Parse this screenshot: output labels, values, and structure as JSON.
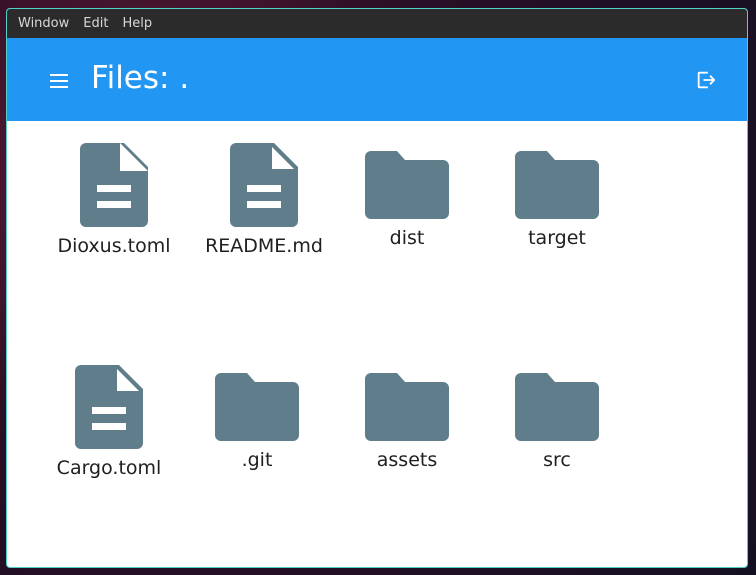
{
  "menubar": {
    "items": [
      "Window",
      "Edit",
      "Help"
    ]
  },
  "header": {
    "title": "Files: .",
    "menu_icon": "hamburger-icon",
    "logout_icon": "logout-icon"
  },
  "colors": {
    "header": "#2196f3",
    "icon": "#607d8b",
    "menubar": "#2b2b2b"
  },
  "files": [
    {
      "name": "Dioxus.toml",
      "type": "file"
    },
    {
      "name": "README.md",
      "type": "file"
    },
    {
      "name": "dist",
      "type": "folder"
    },
    {
      "name": "target",
      "type": "folder"
    },
    {
      "name": "Cargo.toml",
      "type": "file"
    },
    {
      "name": ".git",
      "type": "folder"
    },
    {
      "name": "assets",
      "type": "folder"
    },
    {
      "name": "src",
      "type": "folder"
    }
  ]
}
